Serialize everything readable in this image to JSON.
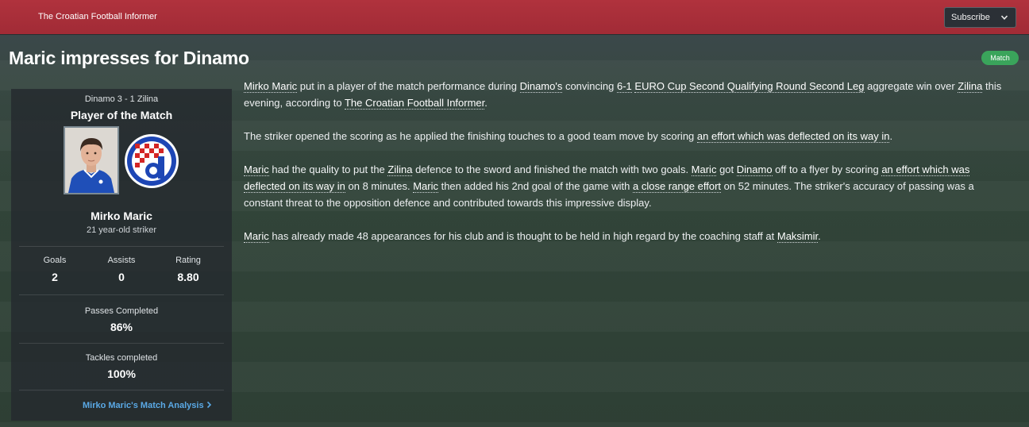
{
  "header": {
    "publication": "The Croatian Football Informer",
    "subscribe_label": "Subscribe"
  },
  "headline": "Maric impresses for Dinamo",
  "tag": "Match",
  "panel": {
    "score_line": "Dinamo 3 - 1 Zilina",
    "award": "Player of the Match",
    "player_name": "Mirko Maric",
    "player_desc": "21 year-old striker",
    "stats": {
      "goals_label": "Goals",
      "goals_value": "2",
      "assists_label": "Assists",
      "assists_value": "0",
      "rating_label": "Rating",
      "rating_value": "8.80",
      "passes_label": "Passes Completed",
      "passes_value": "86%",
      "tackles_label": "Tackles completed",
      "tackles_value": "100%"
    },
    "analysis_link": "Mirko Maric's Match Analysis"
  },
  "article": {
    "p1": {
      "player": "Mirko Maric",
      "t1": " put in a player of the match performance during ",
      "club": "Dinamo's",
      "t2": " convincing ",
      "score": "6-1",
      "t3": " ",
      "competition": "EURO Cup Second Qualifying Round Second Leg",
      "t4": " aggregate win over ",
      "opponent": "Zilina",
      "t5": " this evening, according to ",
      "source": "The Croatian Football Informer",
      "t6": "."
    },
    "p2": {
      "t1": "The striker opened the scoring as he applied the finishing touches to a good team move by scoring ",
      "goal": "an effort which was deflected on its way in",
      "t2": "."
    },
    "p3": {
      "player": "Maric",
      "t1": " had the quality to put the ",
      "opponent": "Zilina",
      "t2": " defence to the sword and finished the match with two goals. ",
      "player2": "Maric",
      "t3": " got ",
      "club": "Dinamo",
      "t4": " off to a flyer by scoring ",
      "goal1": "an effort which was deflected on its way in",
      "t5": " on 8 minutes. ",
      "player3": "Maric",
      "t6": " then added his 2nd goal of the game with ",
      "goal2": "a close range effort",
      "t7": " on 52 minutes. The striker's accuracy of passing was a constant threat to the opposition defence and contributed towards this impressive display."
    },
    "p4": {
      "player": "Maric",
      "t1": " has already made 48 appearances for his club and is thought to be held in high regard by the coaching staff at ",
      "stadium": "Maksimir",
      "t2": "."
    }
  }
}
